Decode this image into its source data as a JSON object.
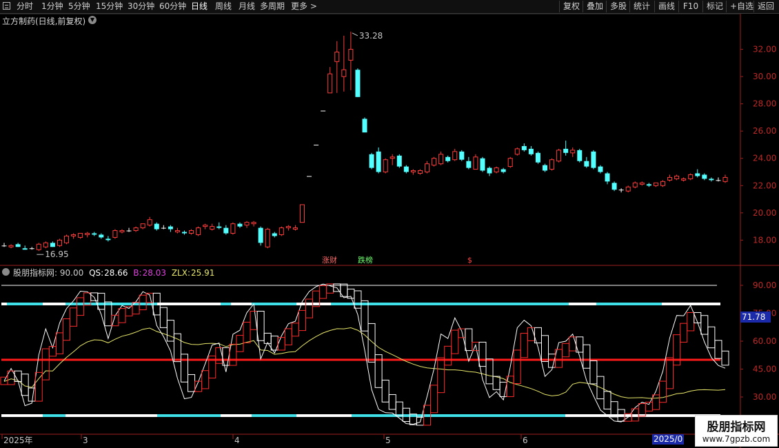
{
  "toolbar": {
    "items": [
      "分时",
      "1分钟",
      "5分钟",
      "15分钟",
      "30分钟",
      "60分钟",
      "日线",
      "周线",
      "月线",
      "多周期",
      "更多 >"
    ],
    "active": "日线",
    "right_items": [
      "复权",
      "叠加",
      "多股",
      "统计",
      "画线",
      "F10",
      "标记",
      "+自选",
      "返回"
    ]
  },
  "chart": {
    "title": "立方制药(日线,前复权)",
    "high_label": "33.28",
    "low_label": "16.95",
    "event_tags": [
      "涨财",
      "跌榜",
      "$"
    ],
    "colors": {
      "up": "#ff3c3c",
      "down": "#54ffff",
      "flat": "#ffffff",
      "indicator_white": "#ffffff",
      "indicator_yellow": "#e8e86a"
    }
  },
  "indicator": {
    "name": "股朋指标网",
    "param": ": 90.00",
    "qs_label": "QS:",
    "qs_value": "28.66",
    "b_label": "B:",
    "b_value": "28.03",
    "zlx_label": "ZLX:",
    "zlx_value": "25.91",
    "current_value_badge": "71.78"
  },
  "x_axis": {
    "labels": [
      "2025年",
      "3",
      "4",
      "5",
      "6"
    ],
    "current_date_badge": "2025/0"
  },
  "watermark": {
    "line1": "股朋指标网",
    "line2": "www.7gpzb.com"
  },
  "chart_data": {
    "type": "candlestick",
    "y_axis_ticks": [
      18.0,
      20.0,
      22.0,
      24.0,
      26.0,
      28.0,
      30.0,
      32.0
    ],
    "ylim": [
      16.3,
      34.0
    ],
    "candles": [
      {
        "o": 17.6,
        "h": 17.8,
        "l": 17.5,
        "c": 17.6
      },
      {
        "o": 17.5,
        "h": 17.7,
        "l": 17.4,
        "c": 17.6
      },
      {
        "o": 17.7,
        "h": 17.8,
        "l": 17.5,
        "c": 17.5
      },
      {
        "o": 17.4,
        "h": 17.6,
        "l": 17.3,
        "c": 17.3
      },
      {
        "o": 17.4,
        "h": 17.5,
        "l": 17.3,
        "c": 17.4
      },
      {
        "o": 17.3,
        "h": 17.8,
        "l": 17.2,
        "c": 17.7
      },
      {
        "o": 17.5,
        "h": 17.9,
        "l": 17.4,
        "c": 17.8
      },
      {
        "o": 17.8,
        "h": 17.9,
        "l": 17.5,
        "c": 17.5
      },
      {
        "o": 17.6,
        "h": 18.1,
        "l": 17.5,
        "c": 18.0
      },
      {
        "o": 17.8,
        "h": 18.4,
        "l": 17.7,
        "c": 18.3
      },
      {
        "o": 18.3,
        "h": 18.5,
        "l": 18.1,
        "c": 18.4
      },
      {
        "o": 18.2,
        "h": 18.5,
        "l": 18.1,
        "c": 18.5
      },
      {
        "o": 18.4,
        "h": 18.6,
        "l": 18.2,
        "c": 18.5
      },
      {
        "o": 18.5,
        "h": 18.6,
        "l": 18.3,
        "c": 18.4
      },
      {
        "o": 18.4,
        "h": 18.5,
        "l": 18.1,
        "c": 18.2
      },
      {
        "o": 18.1,
        "h": 18.3,
        "l": 17.9,
        "c": 18.0
      },
      {
        "o": 18.2,
        "h": 18.8,
        "l": 18.1,
        "c": 18.7
      },
      {
        "o": 18.6,
        "h": 18.8,
        "l": 18.5,
        "c": 18.7
      },
      {
        "o": 18.7,
        "h": 18.9,
        "l": 18.6,
        "c": 18.7
      },
      {
        "o": 18.7,
        "h": 19.0,
        "l": 18.6,
        "c": 18.9
      },
      {
        "o": 18.9,
        "h": 19.2,
        "l": 18.8,
        "c": 19.2
      },
      {
        "o": 19.1,
        "h": 19.7,
        "l": 19.0,
        "c": 19.5
      },
      {
        "o": 19.2,
        "h": 19.3,
        "l": 18.7,
        "c": 18.8
      },
      {
        "o": 18.9,
        "h": 19.1,
        "l": 18.8,
        "c": 18.9
      },
      {
        "o": 19.0,
        "h": 19.1,
        "l": 18.6,
        "c": 18.8
      },
      {
        "o": 18.6,
        "h": 18.9,
        "l": 18.5,
        "c": 18.7
      },
      {
        "o": 18.6,
        "h": 18.7,
        "l": 18.4,
        "c": 18.5
      },
      {
        "o": 18.5,
        "h": 18.8,
        "l": 18.4,
        "c": 18.7
      },
      {
        "o": 18.4,
        "h": 19.0,
        "l": 18.3,
        "c": 18.9
      },
      {
        "o": 19.0,
        "h": 19.2,
        "l": 18.8,
        "c": 19.1
      },
      {
        "o": 18.8,
        "h": 19.2,
        "l": 18.7,
        "c": 19.0
      },
      {
        "o": 19.0,
        "h": 19.3,
        "l": 18.8,
        "c": 18.9
      },
      {
        "o": 18.9,
        "h": 19.1,
        "l": 18.4,
        "c": 18.5
      },
      {
        "o": 18.5,
        "h": 19.3,
        "l": 18.4,
        "c": 19.2
      },
      {
        "o": 19.2,
        "h": 19.3,
        "l": 18.9,
        "c": 19.0
      },
      {
        "o": 19.1,
        "h": 19.4,
        "l": 18.9,
        "c": 19.3
      },
      {
        "o": 19.2,
        "h": 19.4,
        "l": 19.0,
        "c": 19.3
      },
      {
        "o": 18.9,
        "h": 19.0,
        "l": 17.6,
        "c": 17.8
      },
      {
        "o": 17.5,
        "h": 18.9,
        "l": 17.4,
        "c": 18.8
      },
      {
        "o": 18.5,
        "h": 18.6,
        "l": 18.2,
        "c": 18.3
      },
      {
        "o": 18.4,
        "h": 19.0,
        "l": 18.3,
        "c": 18.9
      },
      {
        "o": 18.9,
        "h": 19.1,
        "l": 18.7,
        "c": 19.0
      },
      {
        "o": 18.8,
        "h": 19.1,
        "l": 18.7,
        "c": 18.9
      },
      {
        "o": 19.3,
        "h": 20.6,
        "l": 19.3,
        "c": 20.6
      },
      {
        "o": 22.7,
        "h": 22.7,
        "l": 22.7,
        "c": 22.7
      },
      {
        "o": 25.0,
        "h": 25.0,
        "l": 25.0,
        "c": 25.0
      },
      {
        "o": 27.5,
        "h": 27.5,
        "l": 27.5,
        "c": 27.5
      },
      {
        "o": 28.8,
        "h": 30.7,
        "l": 28.8,
        "c": 30.2
      },
      {
        "o": 31.1,
        "h": 32.6,
        "l": 28.8,
        "c": 31.8
      },
      {
        "o": 30.0,
        "h": 33.0,
        "l": 28.9,
        "c": 30.5
      },
      {
        "o": 31.2,
        "h": 33.3,
        "l": 29.0,
        "c": 32.0
      },
      {
        "o": 30.5,
        "h": 30.6,
        "l": 28.5,
        "c": 28.5
      },
      {
        "o": 26.9,
        "h": 27.0,
        "l": 25.9,
        "c": 25.9
      },
      {
        "o": 24.3,
        "h": 24.4,
        "l": 23.2,
        "c": 23.3
      },
      {
        "o": 24.5,
        "h": 24.8,
        "l": 22.9,
        "c": 23.0
      },
      {
        "o": 23.0,
        "h": 24.0,
        "l": 22.9,
        "c": 23.9
      },
      {
        "o": 24.0,
        "h": 24.3,
        "l": 23.5,
        "c": 24.1
      },
      {
        "o": 24.2,
        "h": 24.3,
        "l": 23.3,
        "c": 23.4
      },
      {
        "o": 23.4,
        "h": 23.5,
        "l": 22.9,
        "c": 23.0
      },
      {
        "o": 23.0,
        "h": 23.2,
        "l": 22.8,
        "c": 23.1
      },
      {
        "o": 22.9,
        "h": 23.2,
        "l": 22.8,
        "c": 23.1
      },
      {
        "o": 23.0,
        "h": 23.8,
        "l": 22.9,
        "c": 23.6
      },
      {
        "o": 23.5,
        "h": 24.1,
        "l": 23.4,
        "c": 24.0
      },
      {
        "o": 23.6,
        "h": 24.5,
        "l": 23.5,
        "c": 24.3
      },
      {
        "o": 24.1,
        "h": 24.2,
        "l": 23.7,
        "c": 23.8
      },
      {
        "o": 23.9,
        "h": 24.7,
        "l": 23.8,
        "c": 24.5
      },
      {
        "o": 24.5,
        "h": 24.6,
        "l": 23.8,
        "c": 23.9
      },
      {
        "o": 23.8,
        "h": 24.1,
        "l": 23.2,
        "c": 23.3
      },
      {
        "o": 23.2,
        "h": 24.3,
        "l": 23.2,
        "c": 24.1
      },
      {
        "o": 24.0,
        "h": 24.1,
        "l": 23.0,
        "c": 23.1
      },
      {
        "o": 23.3,
        "h": 23.4,
        "l": 22.7,
        "c": 22.9
      },
      {
        "o": 23.0,
        "h": 23.4,
        "l": 22.9,
        "c": 23.3
      },
      {
        "o": 23.2,
        "h": 23.3,
        "l": 22.9,
        "c": 23.0
      },
      {
        "o": 23.4,
        "h": 24.1,
        "l": 23.3,
        "c": 24.0
      },
      {
        "o": 24.3,
        "h": 24.8,
        "l": 24.2,
        "c": 24.7
      },
      {
        "o": 24.9,
        "h": 25.1,
        "l": 24.5,
        "c": 24.6
      },
      {
        "o": 24.7,
        "h": 24.9,
        "l": 24.2,
        "c": 24.3
      },
      {
        "o": 24.4,
        "h": 24.5,
        "l": 23.6,
        "c": 23.7
      },
      {
        "o": 23.5,
        "h": 23.6,
        "l": 23.0,
        "c": 23.1
      },
      {
        "o": 23.2,
        "h": 24.0,
        "l": 23.1,
        "c": 23.9
      },
      {
        "o": 23.8,
        "h": 24.7,
        "l": 23.7,
        "c": 24.6
      },
      {
        "o": 24.7,
        "h": 25.3,
        "l": 24.2,
        "c": 24.4
      },
      {
        "o": 24.4,
        "h": 24.8,
        "l": 24.1,
        "c": 24.6
      },
      {
        "o": 24.6,
        "h": 24.7,
        "l": 23.7,
        "c": 23.8
      },
      {
        "o": 23.8,
        "h": 24.1,
        "l": 23.3,
        "c": 23.4
      },
      {
        "o": 24.5,
        "h": 24.6,
        "l": 23.2,
        "c": 23.3
      },
      {
        "o": 23.4,
        "h": 23.5,
        "l": 22.9,
        "c": 23.0
      },
      {
        "o": 22.9,
        "h": 23.0,
        "l": 22.1,
        "c": 22.3
      },
      {
        "o": 22.2,
        "h": 22.3,
        "l": 21.6,
        "c": 21.7
      },
      {
        "o": 21.7,
        "h": 21.8,
        "l": 21.5,
        "c": 21.7
      },
      {
        "o": 21.6,
        "h": 22.0,
        "l": 21.5,
        "c": 21.9
      },
      {
        "o": 21.9,
        "h": 22.3,
        "l": 21.8,
        "c": 22.2
      },
      {
        "o": 22.1,
        "h": 22.3,
        "l": 22.0,
        "c": 22.2
      },
      {
        "o": 22.1,
        "h": 22.2,
        "l": 21.9,
        "c": 22.0
      },
      {
        "o": 22.0,
        "h": 22.2,
        "l": 21.9,
        "c": 22.2
      },
      {
        "o": 22.0,
        "h": 22.4,
        "l": 21.9,
        "c": 22.3
      },
      {
        "o": 22.4,
        "h": 22.8,
        "l": 22.3,
        "c": 22.6
      },
      {
        "o": 22.5,
        "h": 22.8,
        "l": 22.4,
        "c": 22.7
      },
      {
        "o": 22.4,
        "h": 22.6,
        "l": 22.3,
        "c": 22.5
      },
      {
        "o": 22.5,
        "h": 22.9,
        "l": 22.4,
        "c": 22.8
      },
      {
        "o": 22.9,
        "h": 23.2,
        "l": 22.6,
        "c": 22.7
      },
      {
        "o": 22.8,
        "h": 22.9,
        "l": 22.4,
        "c": 22.5
      },
      {
        "o": 22.5,
        "h": 22.6,
        "l": 22.3,
        "c": 22.4
      },
      {
        "o": 22.4,
        "h": 22.6,
        "l": 22.3,
        "c": 22.4
      },
      {
        "o": 22.3,
        "h": 22.8,
        "l": 22.2,
        "c": 22.6
      }
    ],
    "indicator": {
      "y_axis_ticks": [
        30.0,
        45.0,
        60.0,
        75.0,
        90.0
      ],
      "ylim": [
        10,
        100
      ],
      "levels": [
        90,
        80,
        50,
        20
      ],
      "series_names": [
        "QS",
        "B",
        "ZLX"
      ]
    }
  }
}
